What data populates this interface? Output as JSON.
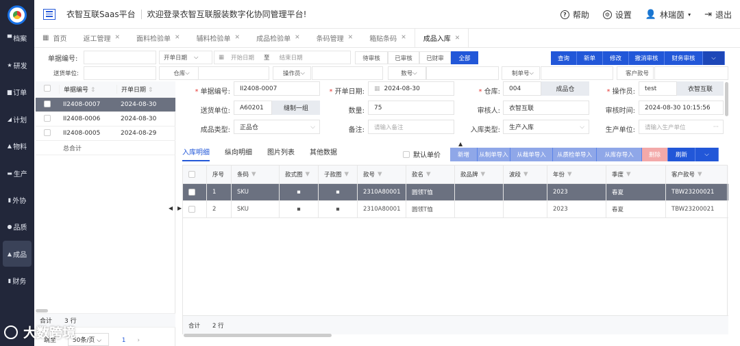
{
  "app": {
    "brand": "衣智互联Saas平台",
    "welcome": "欢迎登录衣智互联服装数字化协同管理平台!",
    "help": "帮助",
    "settings": "设置",
    "user": "林瑞茵",
    "logout": "退出"
  },
  "sidebar": [
    "档案",
    "研发",
    "订单",
    "计划",
    "物料",
    "生产",
    "外协",
    "品质",
    "成品",
    "财务"
  ],
  "tabs": [
    "首页",
    "返工管理",
    "面料检验单",
    "辅料检验单",
    "成品检验单",
    "条码管理",
    "箱贴条码",
    "成品入库"
  ],
  "filter": {
    "doc_no": "单据编号:",
    "start_date": "开单日期",
    "date_start_ph": "开始日期",
    "date_to": "至",
    "date_end_ph": "结束日期",
    "supplier": "送货单位:",
    "warehouse": "仓库",
    "operator": "操作员",
    "qty": "数号",
    "maker": "制单号",
    "customer_no": "客户款号",
    "statuses": [
      "待审核",
      "已审核",
      "已财审",
      "全部"
    ],
    "actions": [
      "查询",
      "新单",
      "修改",
      "撤消审核",
      "财务审核"
    ]
  },
  "left_grid": {
    "headers": [
      "单据编号",
      "开单日期"
    ],
    "rows": [
      [
        "II2408-0007",
        "2024-08-30"
      ],
      [
        "II2408-0006",
        "2024-08-30"
      ],
      [
        "II2408-0005",
        "2024-08-29"
      ]
    ],
    "total_label": "总合计",
    "foot_total": "合计",
    "foot_count": "3 行",
    "page_size": "50条/页",
    "page": "1",
    "jump": "跳至"
  },
  "form": {
    "doc_no_label": "单据编号:",
    "doc_no": "II2408-0007",
    "date_label": "开单日期:",
    "date": "2024-08-30",
    "wh_label": "仓库:",
    "wh_code": "004",
    "wh_name": "成品仓",
    "op_label": "操作员:",
    "op": "test",
    "op_org": "衣智互联",
    "sup_label": "送货单位:",
    "sup_code": "A60201",
    "sup_name": "缝制一组",
    "qty_label": "数量:",
    "qty": "75",
    "rev_label": "审核人:",
    "reviewer": "衣智互联",
    "rev_time_label": "审核时间:",
    "rev_time": "2024-08-30 10:15:56",
    "type_label": "成品类型:",
    "type": "正品仓",
    "note_label": "备注:",
    "note_ph": "请输入备注",
    "in_type_label": "入库类型:",
    "in_type": "生产入库",
    "prod_label": "生产单位:",
    "prod_ph": "请输入生产单位"
  },
  "subtabs": [
    "入库明细",
    "纵向明细",
    "图片列表",
    "其他数据"
  ],
  "default_price": "默认单价",
  "sub_actions": [
    "新增",
    "从制单导入",
    "从裁单导入",
    "从质检单导入",
    "从库存导入",
    "删除",
    "刷新"
  ],
  "detail": {
    "headers": [
      "序号",
      "条码",
      "款式图",
      "子款图",
      "款号",
      "款名",
      "款品牌",
      "波段",
      "年份",
      "季度",
      "客户款号"
    ],
    "rows": [
      [
        "1",
        "SKU",
        "",
        "",
        "2310A80001",
        "圆领T恤",
        "",
        "",
        "2023",
        "春夏",
        "TBW23200021"
      ],
      [
        "2",
        "SKU",
        "",
        "",
        "2310A80001",
        "圆领T恤",
        "",
        "",
        "2023",
        "春夏",
        "TBW23200021"
      ]
    ],
    "foot_total": "合计",
    "foot_count": "2 行"
  },
  "watermark": "大数跨境"
}
